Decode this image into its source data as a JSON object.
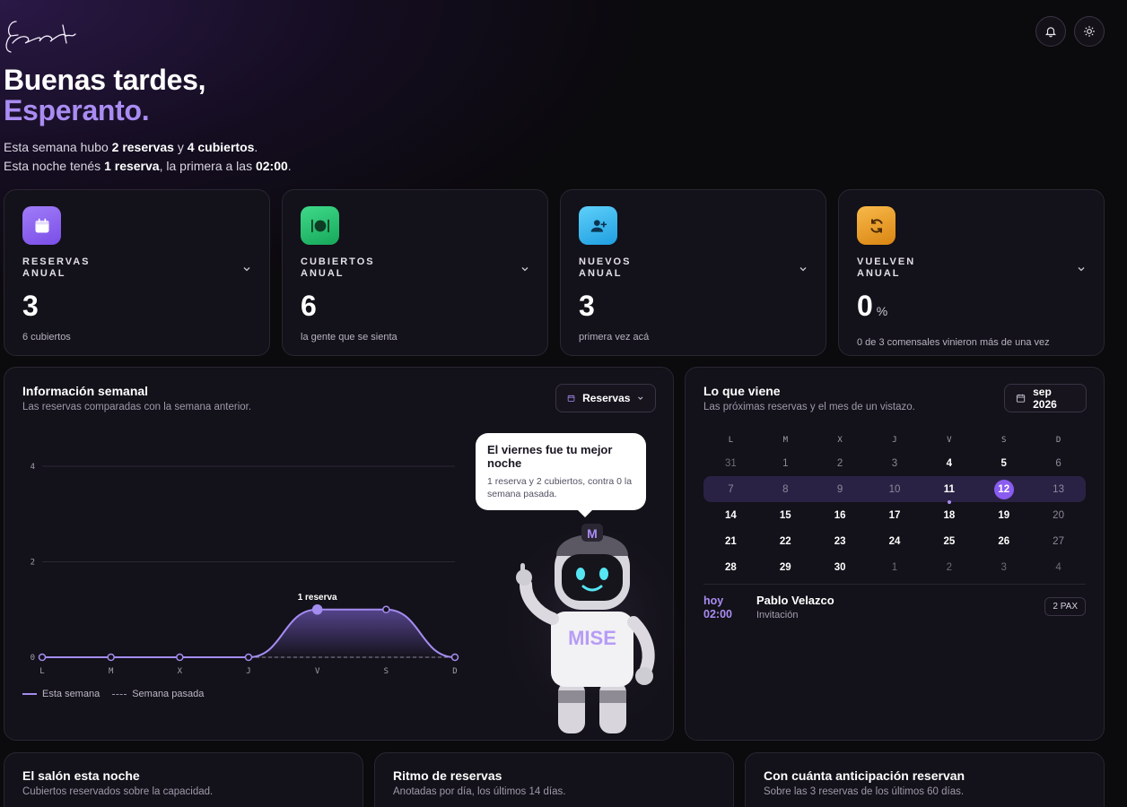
{
  "brand": {
    "logo_text": "Esperanto"
  },
  "header": {
    "greeting_line1": "Buenas tardes,",
    "greeting_name": "Esperanto.",
    "summary_week": {
      "pre": "Esta semana hubo ",
      "reservas": "2 reservas",
      "mid": " y ",
      "cubiertos": "4 cubiertos",
      "post": "."
    },
    "summary_night": {
      "pre": "Esta noche tenés ",
      "reserva": "1 reserva",
      "mid": ", la primera a las ",
      "time": "02:00",
      "post": "."
    }
  },
  "kpis": [
    {
      "label1": "RESERVAS",
      "label2": "ANUAL",
      "value": "3",
      "unit": "",
      "sub": "6 cubiertos",
      "icon": "calendar-icon",
      "color": "#8b5cf6"
    },
    {
      "label1": "CUBIERTOS",
      "label2": "ANUAL",
      "value": "6",
      "unit": "",
      "sub": "la gente que se sienta",
      "icon": "plate-icon",
      "color": "#22c55e"
    },
    {
      "label1": "NUEVOS",
      "label2": "ANUAL",
      "value": "3",
      "unit": "",
      "sub": "primera vez acá",
      "icon": "user-plus-icon",
      "color": "#38bdf8"
    },
    {
      "label1": "VUELVEN",
      "label2": "ANUAL",
      "value": "0",
      "unit": "%",
      "sub": "0 de 3 comensales vinieron más de una vez",
      "icon": "refresh-icon",
      "color": "#f59e0b"
    }
  ],
  "weekly": {
    "title": "Información semanal",
    "subtitle": "Las reservas comparadas con la semana anterior.",
    "dropdown_label": "Reservas",
    "peak_label": "1 reserva",
    "legend_current": "Esta semana",
    "legend_previous": "Semana pasada",
    "bubble_title": "El viernes fue tu mejor noche",
    "bubble_text": "1 reserva y 2 cubiertos, contra 0 la semana pasada.",
    "robot_shirt": "MISE",
    "robot_cap": "M"
  },
  "chart_data": {
    "type": "line",
    "categories": [
      "L",
      "M",
      "X",
      "J",
      "V",
      "S",
      "D"
    ],
    "series": [
      {
        "name": "Esta semana",
        "values": [
          0,
          0,
          0,
          0,
          1,
          1,
          0
        ]
      },
      {
        "name": "Semana pasada",
        "values": [
          0,
          0,
          0,
          0,
          0,
          0,
          0
        ]
      }
    ],
    "yticks": [
      0,
      2,
      4
    ],
    "ylim": [
      0,
      4
    ],
    "colors": {
      "current": "#a48cf0",
      "previous": "#8f8a9a"
    }
  },
  "upcoming": {
    "title": "Lo que viene",
    "subtitle": "Las próximas reservas y el mes de un vistazo.",
    "month_label": "sep 2026",
    "weekdays": [
      "L",
      "M",
      "X",
      "J",
      "V",
      "S",
      "D"
    ],
    "weeks": [
      [
        "31",
        "1",
        "2",
        "3",
        "4",
        "5",
        "6"
      ],
      [
        "7",
        "8",
        "9",
        "10",
        "11",
        "12",
        "13"
      ],
      [
        "14",
        "15",
        "16",
        "17",
        "18",
        "19",
        "20"
      ],
      [
        "21",
        "22",
        "23",
        "24",
        "25",
        "26",
        "27"
      ],
      [
        "28",
        "29",
        "30",
        "1",
        "2",
        "3",
        "4"
      ]
    ],
    "booking": {
      "day": "hoy",
      "time": "02:00",
      "name": "Pablo Velazco",
      "type": "Invitación",
      "pax": "2 PAX"
    }
  },
  "bottom_cards": [
    {
      "title": "El salón esta noche",
      "subtitle": "Cubiertos reservados sobre la capacidad."
    },
    {
      "title": "Ritmo de reservas",
      "subtitle": "Anotadas por día, los últimos 14 días."
    },
    {
      "title": "Con cuánta anticipación reservan",
      "subtitle": "Sobre las 3 reservas de los últimos 60 días."
    }
  ]
}
